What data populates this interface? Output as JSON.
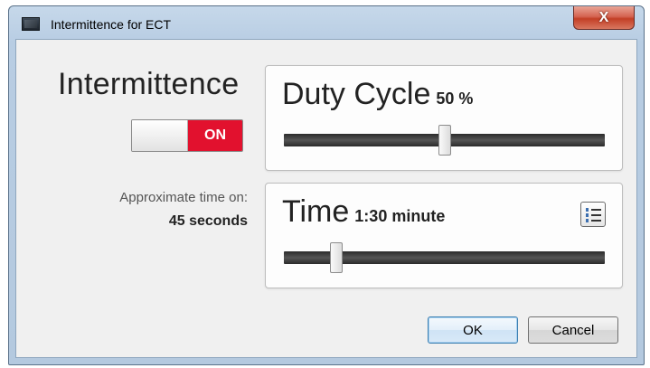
{
  "window": {
    "title": "Intermittence for ECT",
    "close_glyph": "X"
  },
  "intermittence": {
    "label": "Intermittence",
    "toggle_state": "ON"
  },
  "approx": {
    "label": "Approximate time on:",
    "value": "45 seconds"
  },
  "duty_cycle": {
    "label": "Duty Cycle",
    "value_text": "50 %",
    "slider_fraction": 0.5
  },
  "time": {
    "label": "Time",
    "value_text": "1:30 minute",
    "slider_fraction": 0.15,
    "list_icon": "numbered-list-icon"
  },
  "buttons": {
    "ok": "OK",
    "cancel": "Cancel"
  },
  "colors": {
    "toggle_on": "#e2112e",
    "close_button": "#c33f26"
  }
}
